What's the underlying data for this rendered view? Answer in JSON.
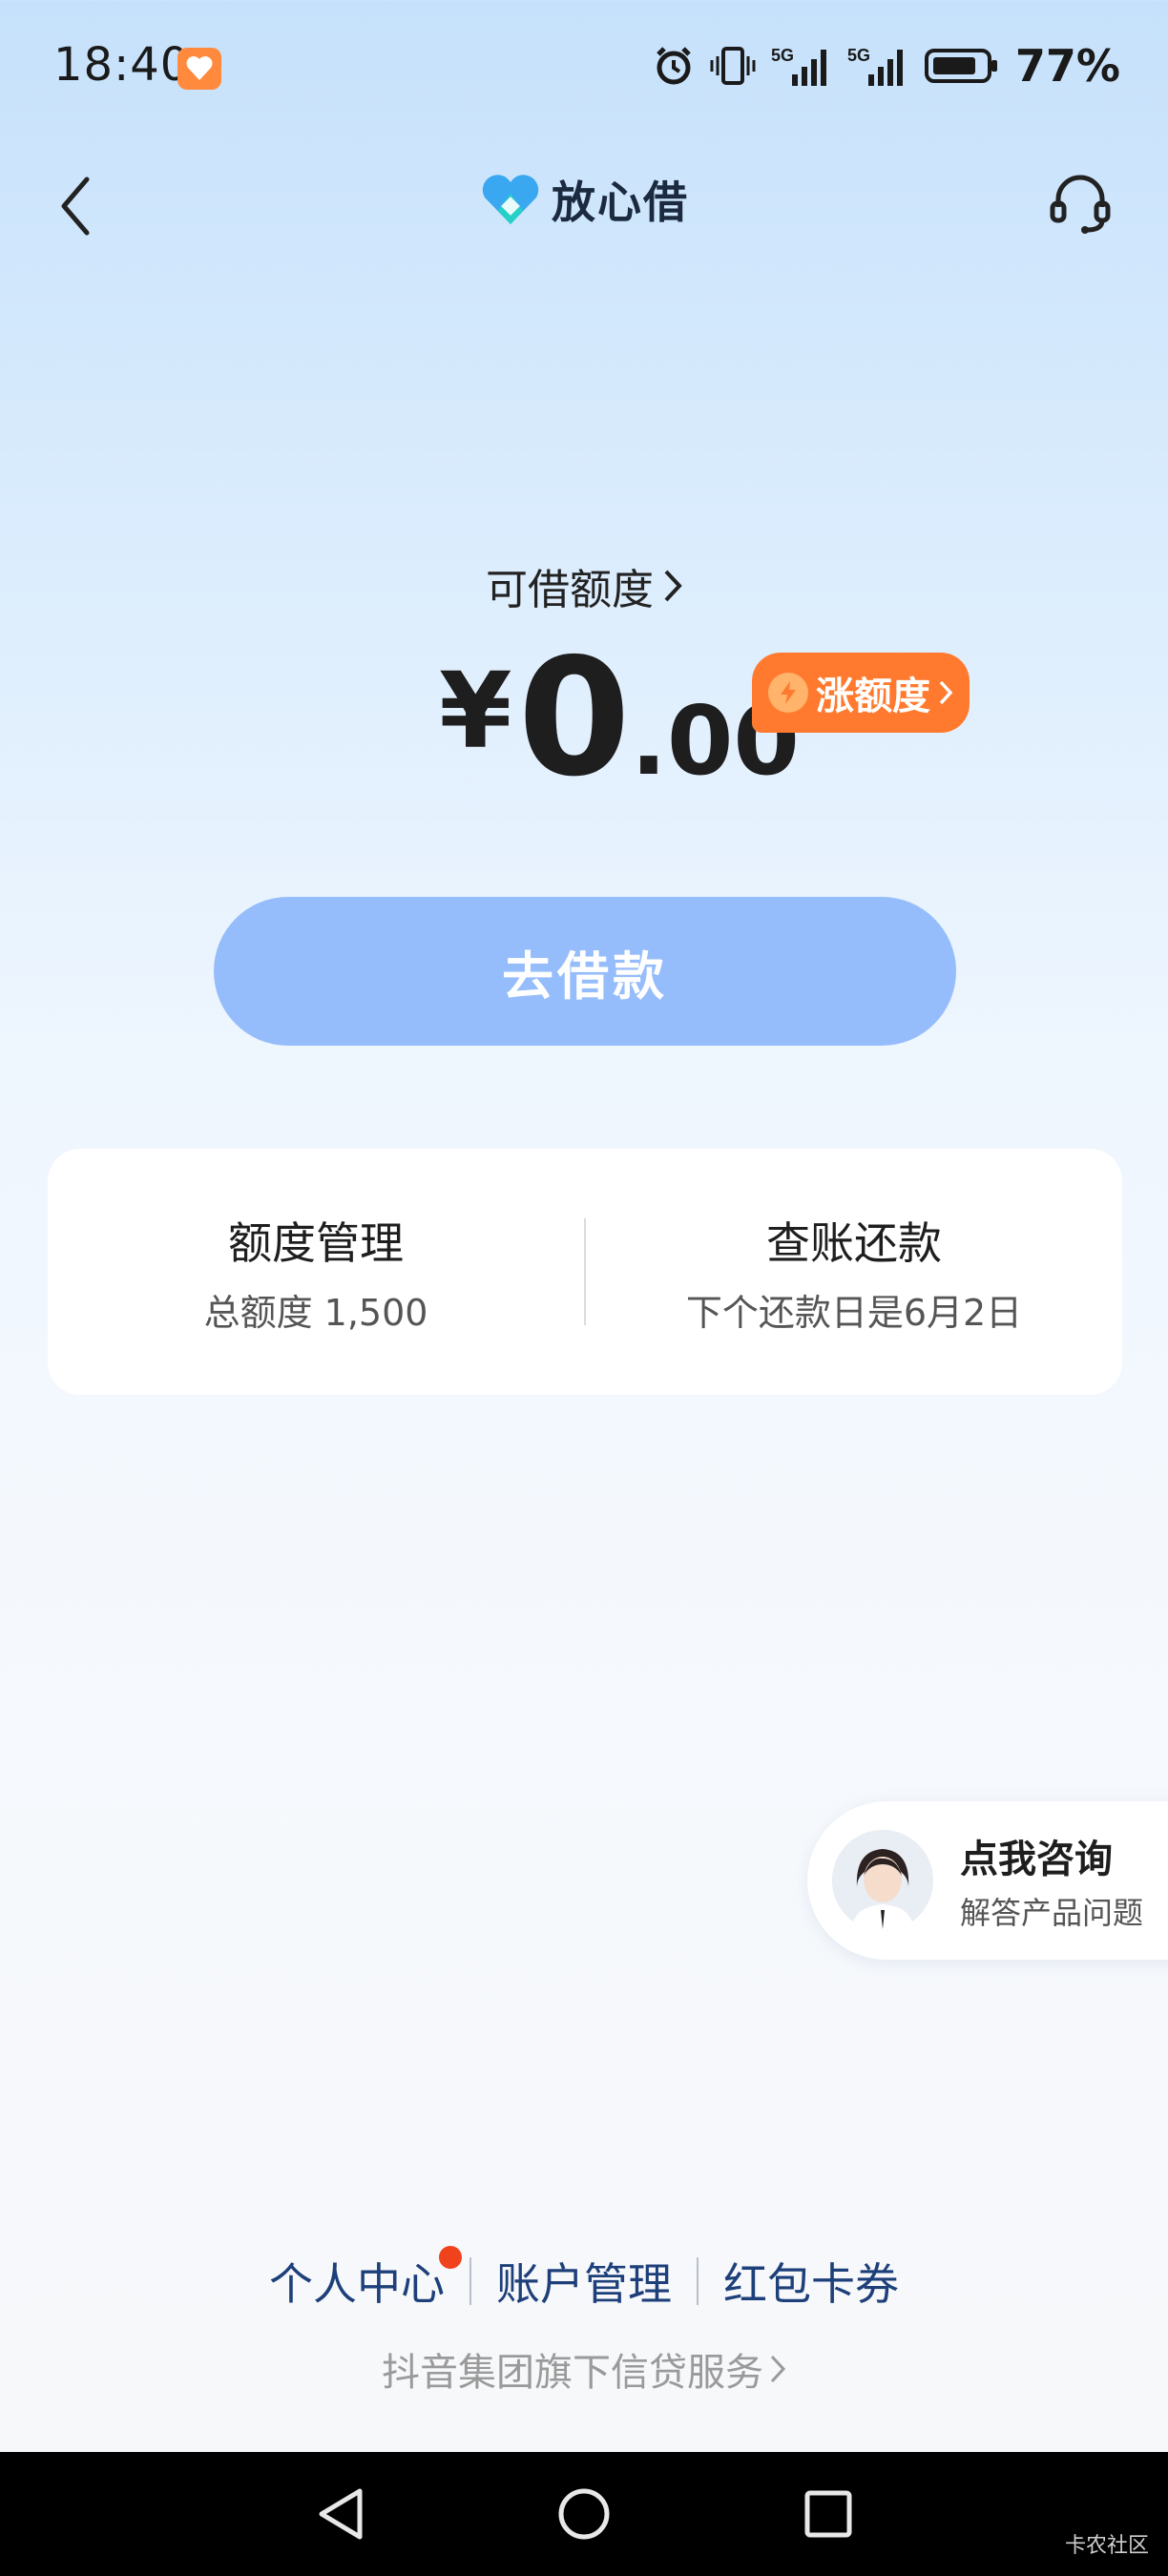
{
  "status_bar": {
    "time": "18:40",
    "battery": "77%",
    "network": [
      "5G",
      "5G"
    ],
    "icons": [
      "alarm-icon",
      "vibrate-icon",
      "signal-icon",
      "signal-icon",
      "battery-icon"
    ]
  },
  "header": {
    "logo_text": "放心借",
    "back_icon": "chevron-left-icon",
    "support_icon": "headset-icon"
  },
  "credit": {
    "label": "可借额度",
    "currency": "¥",
    "integer": "0",
    "decimal": ".00",
    "raise_label": "涨额度"
  },
  "borrow_button": "去借款",
  "card": {
    "left_title": "额度管理",
    "left_sub": "总额度 1,500",
    "right_title": "查账还款",
    "right_sub": "下个还款日是6月2日"
  },
  "consult": {
    "title": "点我咨询",
    "subtitle": "解答产品问题"
  },
  "bottom_links": [
    "个人中心",
    "账户管理",
    "红包卡券"
  ],
  "footer_note": "抖音集团旗下信贷服务",
  "watermark": "卡农社区",
  "colors": {
    "accent_orange": "#ff7a2e",
    "button_blue": "#96bdfb",
    "link_blue": "#1d3f7a",
    "badge_red": "#f0421c"
  }
}
